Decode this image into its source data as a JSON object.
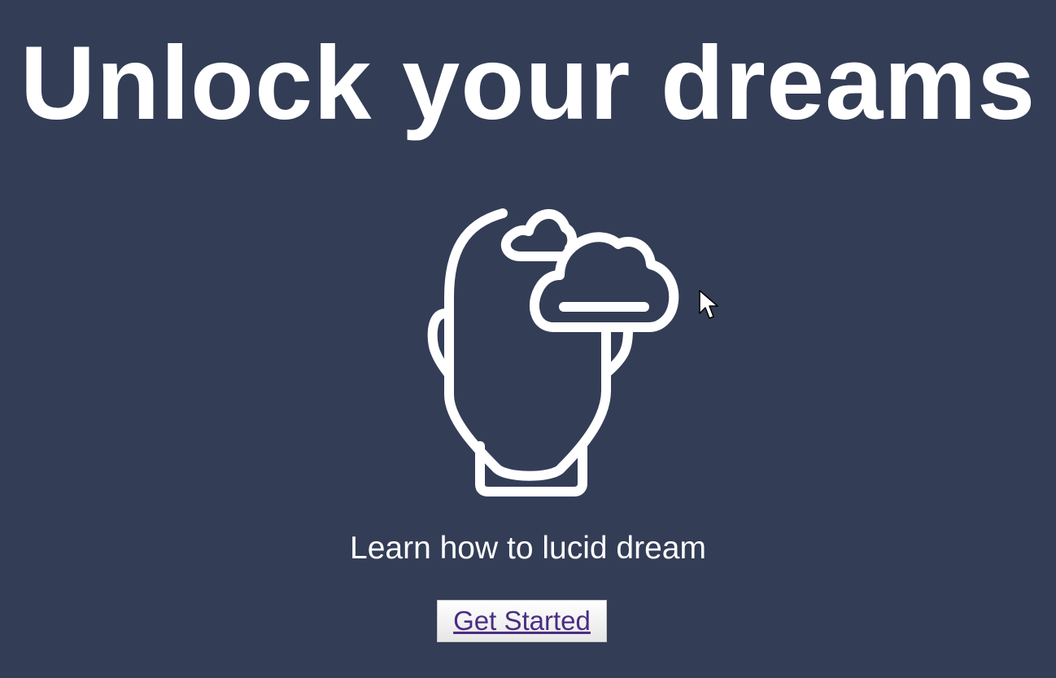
{
  "hero": {
    "title": "Unlock your dreams",
    "illustration_icon": "dreaming-head-with-clouds-icon",
    "subtitle": "Learn how to lucid dream",
    "cta_label": "Get Started"
  },
  "colors": {
    "background": "#333d56",
    "text": "#ffffff",
    "link": "#4a2d83"
  },
  "cursor_icon": "mouse-pointer-icon"
}
